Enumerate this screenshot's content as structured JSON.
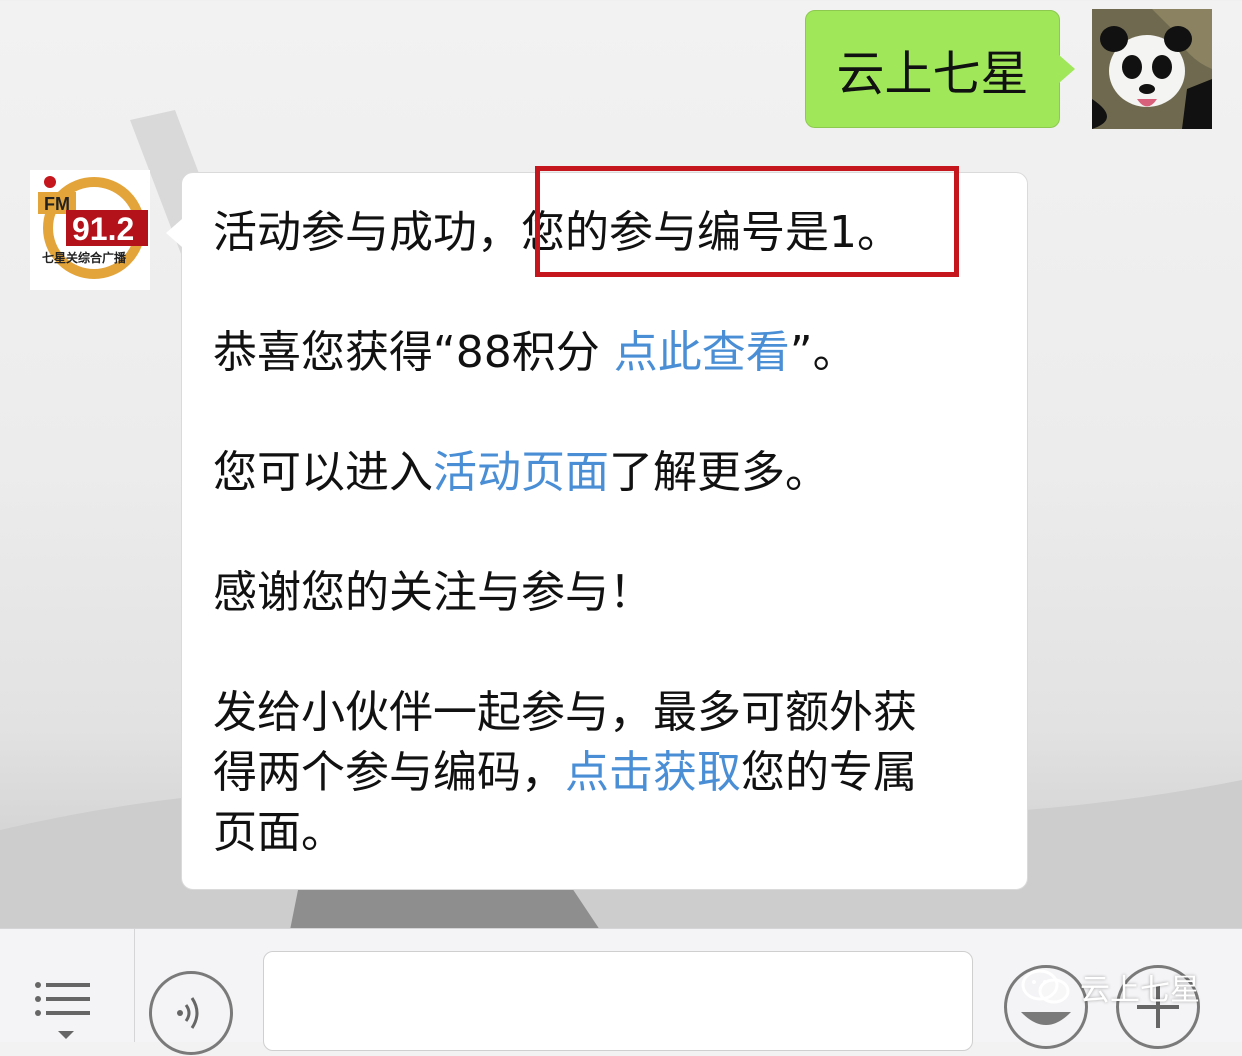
{
  "chat": {
    "outgoing": {
      "text": "云上七星"
    },
    "incoming": {
      "sender_logo": {
        "fm": "FM",
        "frequency": "91.2",
        "station": "七星关综合广播"
      },
      "line1_a": "活动参与成功，",
      "line1_b": "您的参与编号是1。",
      "line2_a": "恭喜您获得“88积分 ",
      "line2_link": "点此查看",
      "line2_b": "”。",
      "line3_a": "您可以进入",
      "line3_link": "活动页面",
      "line3_b": "了解更多。",
      "line4": "感谢您的关注与参与！",
      "line5": "发给小伙伴一起参与，最多可额外获",
      "line6_a": "得两个参与编码，",
      "line6_link": "点击获取",
      "line6_b": "您的专属",
      "line7": "页面。"
    }
  },
  "input_bar": {
    "menu_icon": "menu-list-icon",
    "voice_icon": "voice-icon",
    "emoji_icon": "emoji-icon",
    "plus_icon": "plus-icon"
  },
  "watermark": {
    "text": "云上七星"
  },
  "colors": {
    "outgoing_bubble": "#a0e75a",
    "link": "#4a8fd6",
    "highlight_box": "#c4161c"
  }
}
